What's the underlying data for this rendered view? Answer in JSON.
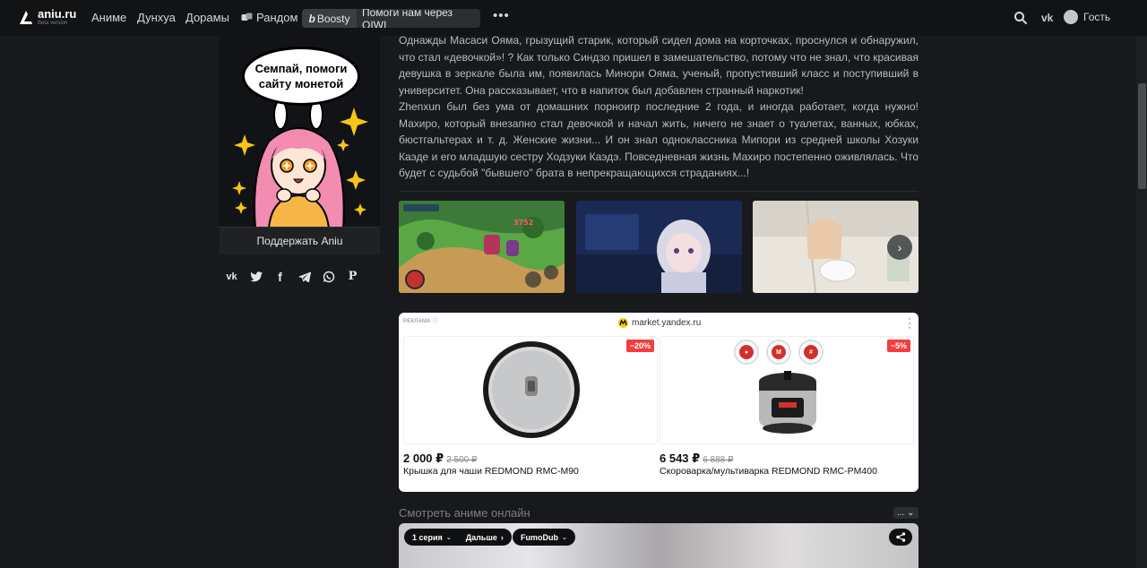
{
  "nav": {
    "logo_name": "aniu.ru",
    "logo_sub": "Beta version",
    "links": [
      "Аниме",
      "Дунхуа",
      "Дорамы"
    ],
    "random_label": "Рандом",
    "boosty_label": "Boosty",
    "qiwi_label": "Помоги нам через QIWI",
    "more_label": "•••",
    "vk_label": "vk",
    "user_label": "Гость"
  },
  "promo": {
    "bubble_text": "Семпай, помоги сайту монетой",
    "support_label": "Поддержать Aniu"
  },
  "share": {
    "icons": [
      "vk-icon",
      "twitter-icon",
      "facebook-icon",
      "telegram-icon",
      "whatsapp-icon",
      "pinterest-icon"
    ],
    "vk_glyph": "vk",
    "fb_glyph": "f",
    "pin_glyph": "P"
  },
  "description": {
    "text": "Однажды Масаси Ояма, грызущий старик, который сидел дома на корточках, проснулся и обнаружил, что стал «девочкой»! ? Как только Синдзо пришел в замешательство, потому что не знал, что красивая девушка в зеркале была им, появилась Минори Ояма, ученый, пропустивший класс и поступивший в университет. Она рассказывает, что в напиток был добавлен странный наркотик!\nZhenxun был без ума от домашних порноигр последние 2 года, и иногда работает, когда нужно! Махиро, который внезапно стал девочкой и начал жить, ничего не знает о туалетах, ванных, юбках, бюстгальтерах и т. д. Женские жизни... И он знал одноклассника Мипори из средней школы Хозуки Каэде и его младшую сестру Ходзуки Каэдэ. Повседневная жизнь Махиро постепенно оживлялась. Что будет с судьбой \"бывшего\" брата в непрекращающихся страданиях...!"
  },
  "screenshots": {
    "next_label": "›",
    "game_hud_text": "3752"
  },
  "ad": {
    "label": "РЕКЛАМА",
    "source": "market.yandex.ru",
    "products": [
      {
        "title": "Крышка для чаши REDMOND RMC-M90",
        "price": "2 000 ₽",
        "old_price": "2 500 ₽",
        "discount": "−20%"
      },
      {
        "title": "Скороварка/мультиварка REDMOND RMC-PM400",
        "price": "6 543 ₽",
        "old_price": "6 888 ₽",
        "discount": "−5%"
      }
    ]
  },
  "watch": {
    "title": "Смотреть аниме онлайн",
    "menu_label": "... ⌄",
    "episode_label": "1 серия",
    "next_label": "Дальше",
    "dub_label": "FumoDub"
  },
  "colors": {
    "background": "#17191c",
    "topbar": "#121315",
    "discount_red": "#f43d3d",
    "accent_yellow": "#f5c518"
  }
}
